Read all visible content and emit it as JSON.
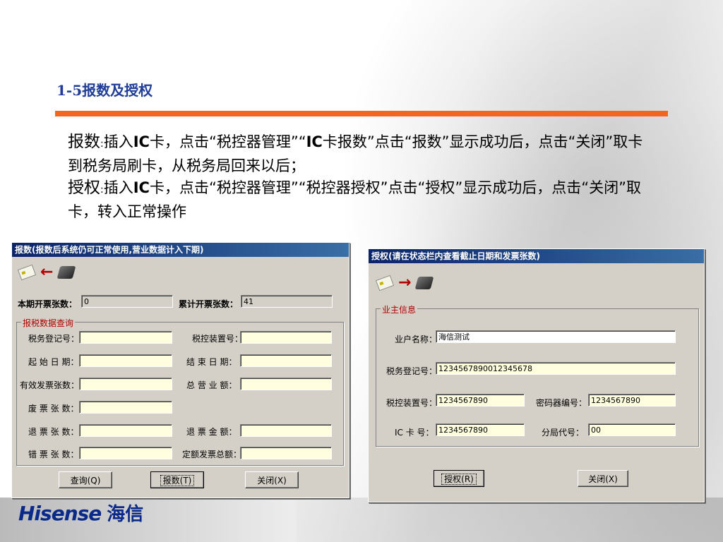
{
  "slide": {
    "title": "1-5报数及授权",
    "para1_lead": "报数",
    "para1_colon": ":",
    "para1_text_a": "插入",
    "para1_bold_a": "IC",
    "para1_text_b": "卡，点击“税控器管理”“",
    "para1_bold_b": "IC",
    "para1_text_c": "卡报数”点击“报数”显示成功后，点击“关闭”取卡到税务局刷卡，从税务局回来以后；",
    "para2_lead": "授权",
    "para2_colon": ":",
    "para2_text_a": "插入",
    "para2_bold_a": "IC",
    "para2_text_b": "卡，点击“税控器管理”“税控器授权”点击“授权”显示成功后，点击“关闭”取卡，转入正常操作"
  },
  "colors": {
    "title_blue": "#1f3d99",
    "accent_orange": "#f26522",
    "titlebar_blue": "#0a246a",
    "legend_red": "#b00000",
    "field_yellow": "#ffffe0"
  },
  "icons": [
    "ic-card-icon",
    "left-arrow-icon",
    "card-reader-icon",
    "right-arrow-icon"
  ],
  "report_dialog": {
    "title": "报数(报数后系统仍可正常使用,营业数据计入下期)",
    "current_count_label": "本期开票张数：",
    "current_count_value": "0",
    "total_count_label": "累计开票张数：",
    "total_count_value": "41",
    "group_label": "报税数据查询",
    "fields": {
      "tax_reg_label": "税务登记号：",
      "tax_device_label": "税控装置号：",
      "start_date_label": "起 始 日 期：",
      "end_date_label": "结 束 日 期：",
      "valid_invoices_label": "有效发票张数：",
      "total_revenue_label": "总 营 业 额：",
      "void_count_label": "废 票 张 数：",
      "refund_count_label": "退 票 张 数：",
      "refund_amount_label": "退 票 金 额：",
      "error_count_label": "错 票 张 数：",
      "fixed_invoice_total_label": "定额发票总额："
    },
    "buttons": {
      "query": "查询(Q)",
      "report": "报数(T)",
      "close": "关闭(X)"
    }
  },
  "auth_dialog": {
    "title": "授权(请在状态栏内查看截止日期和发票张数)",
    "group_label": "业主信息",
    "owner_name_label": "业户名称：",
    "owner_name_value": "海信测试",
    "tax_reg_label": "税务登记号：",
    "tax_reg_value": "1234567890012345678",
    "tax_device_label": "税控装置号：",
    "tax_device_value": "1234567890",
    "cipher_no_label": "密码器编号：",
    "cipher_no_value": "1234567890",
    "ic_card_label": "IC 卡 号：",
    "ic_card_value": "1234567890",
    "branch_code_label": "分局代号：",
    "branch_code_value": "00",
    "buttons": {
      "authorize": "授权(R)",
      "close": "关闭(X)"
    }
  },
  "logo": {
    "brand": "Hisense",
    "brand_cn": "海信"
  }
}
